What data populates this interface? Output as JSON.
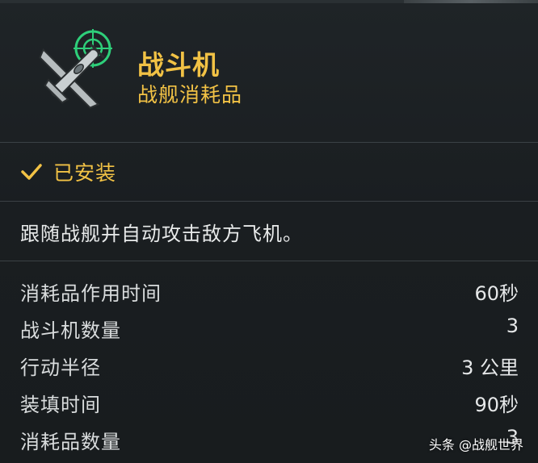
{
  "header": {
    "title": "战斗机",
    "subtitle": "战舰消耗品",
    "icon": "fighter-plane-icon"
  },
  "status": {
    "installed_label": "已安装",
    "icon": "checkmark-icon"
  },
  "description": "跟随战舰并自动攻击敌方飞机。",
  "stats": [
    {
      "label": "消耗品作用时间",
      "value": "60秒"
    },
    {
      "label": "战斗机数量",
      "value": "3"
    },
    {
      "label": "行动半径",
      "value": "3 公里"
    },
    {
      "label": "装填时间",
      "value": "90秒"
    },
    {
      "label": "消耗品数量",
      "value": "3"
    }
  ],
  "watermark": "头条 @战舰世界",
  "colors": {
    "accent": "#f2c245",
    "target_ring": "#2ecf7a",
    "background": "#1c2023"
  }
}
